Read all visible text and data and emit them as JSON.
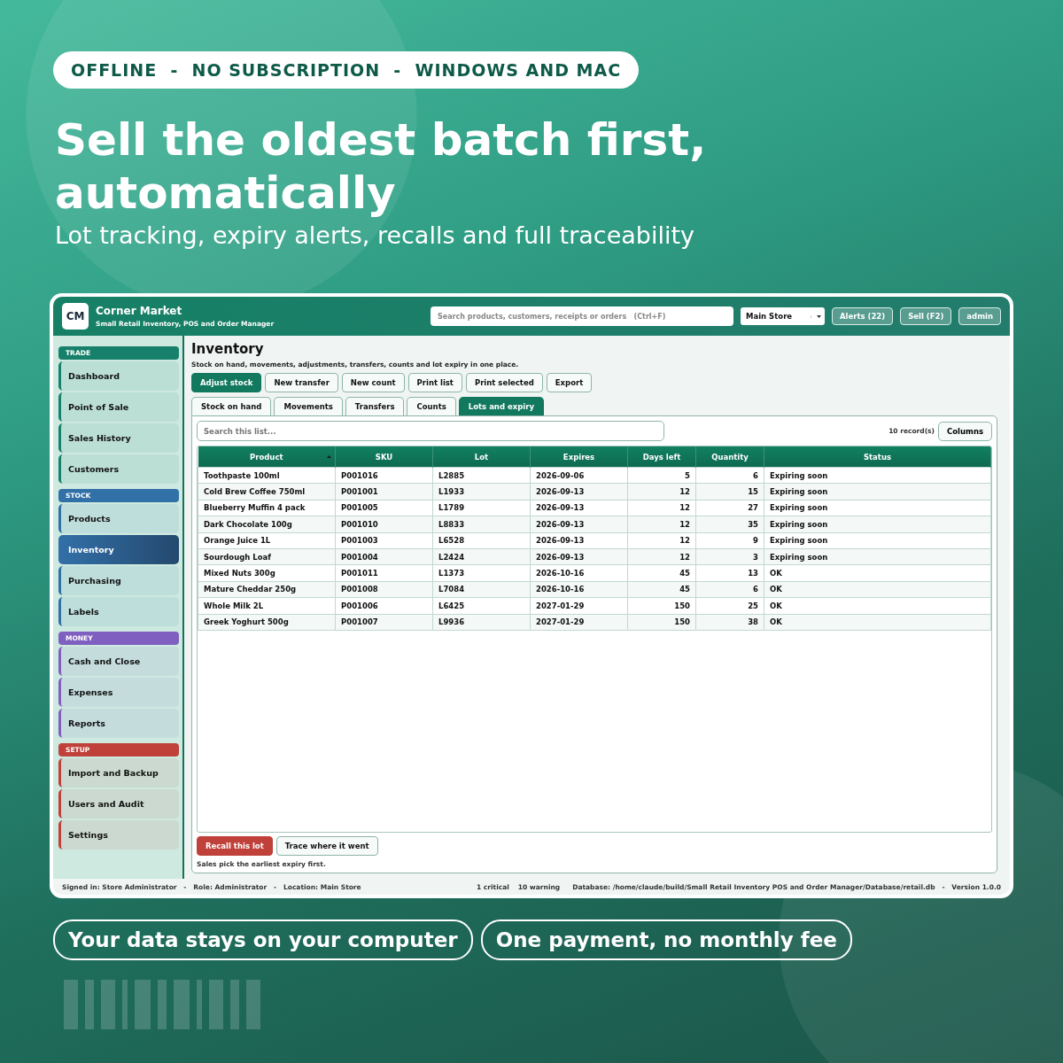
{
  "banner": {
    "tagline": "OFFLINE  -  NO SUBSCRIPTION  -  WINDOWS AND MAC",
    "headline": "Sell the oldest batch first, automatically",
    "subheadline": "Lot tracking, expiry alerts, recalls and full traceability"
  },
  "app": {
    "logo": "CM",
    "title": "Corner Market",
    "subtitle": "Small Retail Inventory, POS and Order Manager",
    "search": {
      "placeholder": "Search products, customers, receipts or orders   (Ctrl+F)"
    },
    "store": "Main Store",
    "header_buttons": [
      "Alerts (22)",
      "Sell  (F2)",
      "admin"
    ],
    "sidebar": [
      {
        "title": "TRADE",
        "color": "#17806a",
        "items": [
          {
            "label": "Dashboard",
            "selected": false
          },
          {
            "label": "Point of Sale",
            "selected": false
          },
          {
            "label": "Sales History",
            "selected": false
          },
          {
            "label": "Customers",
            "selected": false
          }
        ]
      },
      {
        "title": "STOCK",
        "color": "#3270a8",
        "items": [
          {
            "label": "Products",
            "selected": false
          },
          {
            "label": "Inventory",
            "selected": true
          },
          {
            "label": "Purchasing",
            "selected": false
          },
          {
            "label": "Labels",
            "selected": false
          }
        ]
      },
      {
        "title": "MONEY",
        "color": "#7f5fc0",
        "items": [
          {
            "label": "Cash and Close",
            "selected": false
          },
          {
            "label": "Expenses",
            "selected": false
          },
          {
            "label": "Reports",
            "selected": false
          }
        ]
      },
      {
        "title": "SETUP",
        "color": "#c0403a",
        "items": [
          {
            "label": "Import and Backup",
            "selected": false
          },
          {
            "label": "Users and Audit",
            "selected": false
          },
          {
            "label": "Settings",
            "selected": false
          }
        ]
      }
    ],
    "page": {
      "title": "Inventory",
      "description": "Stock on hand, movements, adjustments, transfers, counts and lot expiry in one place.",
      "actions": [
        {
          "label": "Adjust stock",
          "kind": "primary"
        },
        {
          "label": "New transfer",
          "kind": "plain"
        },
        {
          "label": "New count",
          "kind": "plain"
        },
        {
          "label": "Print list",
          "kind": "plain"
        },
        {
          "label": "Print selected",
          "kind": "plain"
        },
        {
          "label": "Export",
          "kind": "plain"
        }
      ],
      "tabs": [
        {
          "label": "Stock on hand",
          "selected": false
        },
        {
          "label": "Movements",
          "selected": false
        },
        {
          "label": "Transfers",
          "selected": false
        },
        {
          "label": "Counts",
          "selected": false
        },
        {
          "label": "Lots and expiry",
          "selected": true
        }
      ],
      "list_search": {
        "placeholder": "Search this list..."
      },
      "record_count": "10 record(s)",
      "columns_button": "Columns",
      "table": {
        "columns": [
          {
            "label": "Product",
            "sorted": true
          },
          {
            "label": "SKU",
            "sorted": false
          },
          {
            "label": "Lot",
            "sorted": false
          },
          {
            "label": "Expires",
            "sorted": false
          },
          {
            "label": "Days left",
            "sorted": false
          },
          {
            "label": "Quantity",
            "sorted": false
          },
          {
            "label": "Status",
            "sorted": false
          }
        ],
        "rows": [
          [
            "Toothpaste 100ml",
            "P001016",
            "L2885",
            "2026-09-06",
            "5",
            "6",
            "Expiring soon"
          ],
          [
            "Cold Brew Coffee 750ml",
            "P001001",
            "L1933",
            "2026-09-13",
            "12",
            "15",
            "Expiring soon"
          ],
          [
            "Blueberry Muffin 4 pack",
            "P001005",
            "L1789",
            "2026-09-13",
            "12",
            "27",
            "Expiring soon"
          ],
          [
            "Dark Chocolate 100g",
            "P001010",
            "L8833",
            "2026-09-13",
            "12",
            "35",
            "Expiring soon"
          ],
          [
            "Orange Juice 1L",
            "P001003",
            "L6528",
            "2026-09-13",
            "12",
            "9",
            "Expiring soon"
          ],
          [
            "Sourdough Loaf",
            "P001004",
            "L2424",
            "2026-09-13",
            "12",
            "3",
            "Expiring soon"
          ],
          [
            "Mixed Nuts 300g",
            "P001011",
            "L1373",
            "2026-10-16",
            "45",
            "13",
            "OK"
          ],
          [
            "Mature Cheddar 250g",
            "P001008",
            "L7084",
            "2026-10-16",
            "45",
            "6",
            "OK"
          ],
          [
            "Whole Milk 2L",
            "P001006",
            "L6425",
            "2027-01-29",
            "150",
            "25",
            "OK"
          ],
          [
            "Greek Yoghurt 500g",
            "P001007",
            "L9936",
            "2027-01-29",
            "150",
            "38",
            "OK"
          ]
        ]
      },
      "footer_actions": [
        {
          "label": "Recall this lot",
          "kind": "danger"
        },
        {
          "label": "Trace where it went",
          "kind": "plain"
        }
      ],
      "note": "Sales pick the earliest expiry first."
    },
    "status_bar": {
      "signed_in": "Signed in: Store Administrator   -   Role: Administrator   -   Location: Main Store",
      "critical": "1 critical",
      "warning": "10 warning",
      "database": "Database: /home/claude/build/Small Retail Inventory POS and Order Manager/Database/retail.db   -   Version 1.0.0"
    }
  },
  "bottom_pills": [
    "Your data stays on your computer",
    "One payment, no monthly fee"
  ]
}
